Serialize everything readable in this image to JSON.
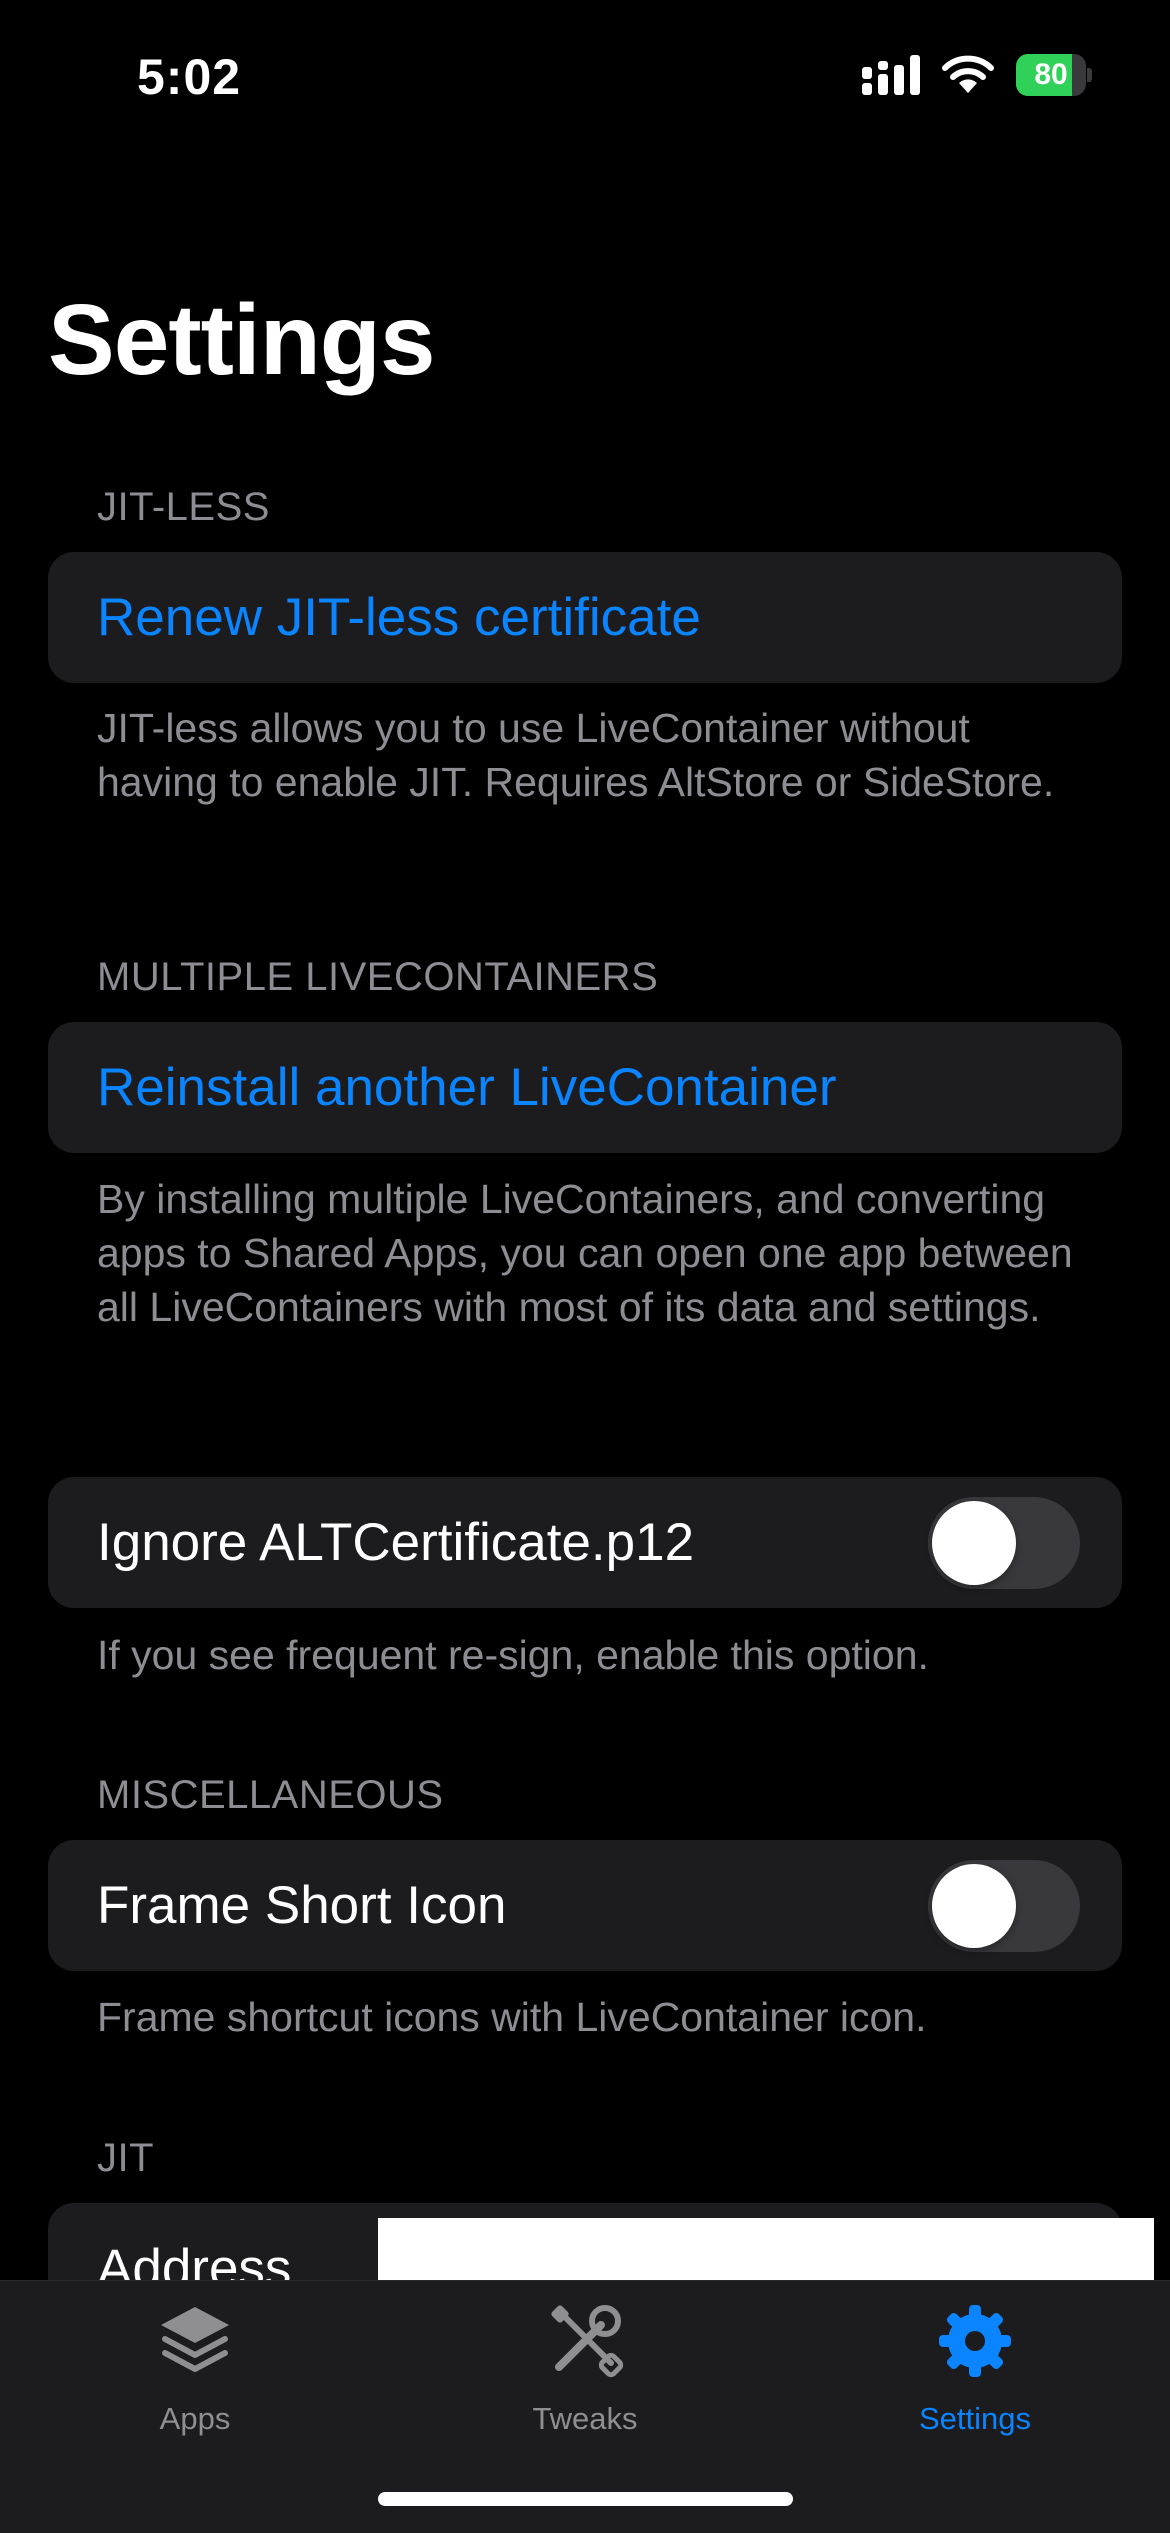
{
  "status_bar": {
    "time": "5:02",
    "battery_percent": 80,
    "battery_label": "80"
  },
  "page_title": "Settings",
  "sections": {
    "jit_less": {
      "header": "JIT-LESS",
      "button": "Renew JIT-less certificate",
      "footer": "JIT-less allows you to use LiveContainer without having to enable JIT. Requires AltStore or SideStore."
    },
    "multiple": {
      "header": "MULTIPLE LIVECONTAINERS",
      "button": "Reinstall another LiveContainer",
      "footer": "By installing multiple LiveContainers, and converting apps to Shared Apps, you can open one app between all LiveContainers with most of its data and settings."
    },
    "ignore_cert": {
      "label": "Ignore ALTCertificate.p12",
      "enabled": false,
      "footer": "If you see frequent re-sign, enable this option."
    },
    "misc": {
      "header": "MISCELLANEOUS",
      "label": "Frame Short Icon",
      "enabled": false,
      "footer": "Frame shortcut icons with LiveContainer icon."
    },
    "jit": {
      "header": "JIT",
      "address_label": "Address"
    }
  },
  "tab_bar": {
    "tabs": [
      {
        "label": "Apps",
        "icon": "stack-icon",
        "selected": false
      },
      {
        "label": "Tweaks",
        "icon": "tools-icon",
        "selected": false
      },
      {
        "label": "Settings",
        "icon": "gear-icon",
        "selected": true
      }
    ]
  },
  "colors": {
    "accent": "#0a84ff",
    "background": "#000000",
    "cell": "#1c1c1e",
    "secondary_text": "#8d8d93",
    "battery": "#30d158"
  }
}
